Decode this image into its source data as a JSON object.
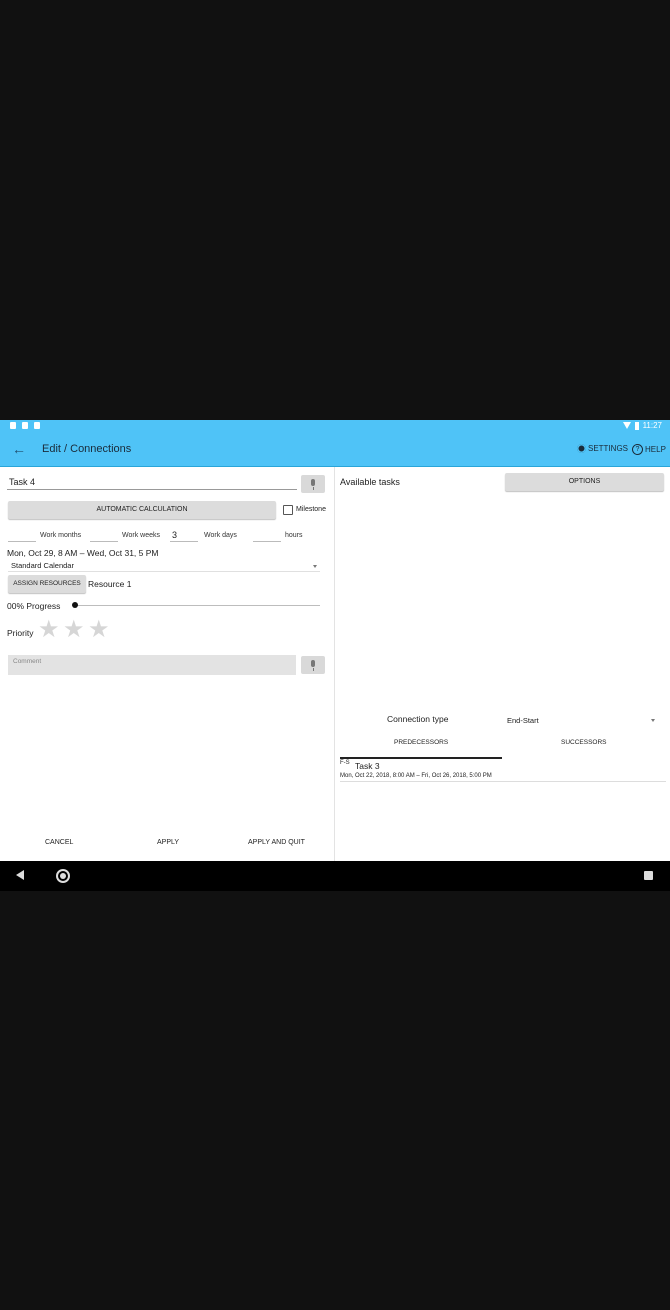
{
  "statusbar": {
    "time": "11:27"
  },
  "appbar": {
    "back_icon": "arrow-left-icon",
    "title": "Edit / Connections",
    "settings_label": "SETTINGS",
    "help_label": "HELP"
  },
  "left": {
    "task_name": "Task 4",
    "auto_calc_label": "AUTOMATIC CALCULATION",
    "milestone_label": "Milestone",
    "milestone_checked": false,
    "work_months_label": "Work months",
    "work_months_value": "",
    "work_weeks_label": "Work weeks",
    "work_weeks_value": "",
    "work_days_label": "Work days",
    "work_days_value": "3",
    "hours_label": "hours",
    "hours_value": "",
    "date_range": "Mon, Oct 29, 8 AM – Wed, Oct 31, 5 PM",
    "calendar": "Standard Calendar",
    "assign_resources_label": "ASSIGN RESOURCES",
    "resource": "Resource 1",
    "progress_label": "00% Progress",
    "progress_fraction": 0,
    "priority_label": "Priority",
    "priority_stars": 0,
    "priority_max": 3,
    "comment_placeholder": "Comment",
    "cancel_label": "CANCEL",
    "apply_label": "APPLY",
    "apply_quit_label": "APPLY AND QUIT"
  },
  "right": {
    "available_tasks_label": "Available tasks",
    "options_label": "OPTIONS",
    "connection_type_label": "Connection type",
    "connection_type_value": "End-Start",
    "tabs": [
      {
        "label": "PREDECESSORS",
        "active": true
      },
      {
        "label": "SUCCESSORS",
        "active": false
      }
    ],
    "predecessors": [
      {
        "type_code": "F-S",
        "name": "Task 3",
        "dates": "Mon, Oct 22, 2018, 8:00 AM – Fri, Oct 26, 2018, 5:00 PM"
      }
    ]
  },
  "colors": {
    "accent": "#4fc3f7",
    "navbar": "#000000",
    "background": "#111111"
  }
}
